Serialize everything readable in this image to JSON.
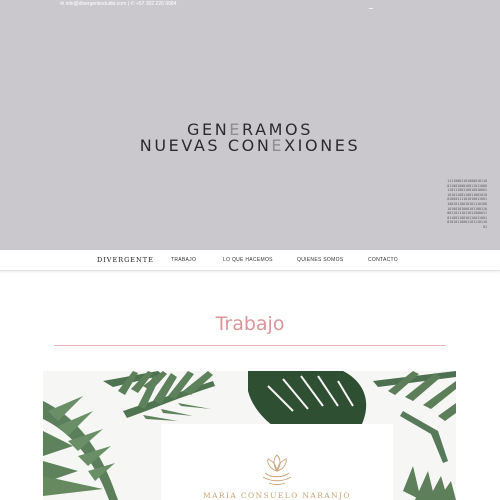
{
  "topbar": {
    "email": "info@divergentestudio.com",
    "separator": "|",
    "phone": "+57 302 226 9684",
    "icons": [
      "mail-icon",
      "phone-icon",
      "instagram-icon",
      "vimeo-icon"
    ]
  },
  "hero": {
    "line1_a": "GEN",
    "line1_hl": "E",
    "line1_b": "RAMOS",
    "line2_a": "NUEVAS CON",
    "line2_hl": "E",
    "line2_b": "XIONES",
    "side_text": "1111000110100001011001100100010011011000110111001100100100011010110011001100101001000111101010011001100101100101011101001010010100010110011000110111011011000011011001100101100110010101011000110111011001"
  },
  "nav": {
    "logo": "DIVERGENTE",
    "items": [
      "TRABAJO",
      "LO QUE HACEMOS",
      "QUIENES SOMOS",
      "CONTACTO"
    ]
  },
  "section": {
    "title": "Trabajo"
  },
  "portfolio": {
    "card_name": "MARIA CONSUELO NARANJO"
  },
  "colors": {
    "hero_bg": "#cbc8cd",
    "accent_pink": "#d9969a",
    "gold": "#c8a477",
    "leaf_green": "#3a5a3c"
  }
}
